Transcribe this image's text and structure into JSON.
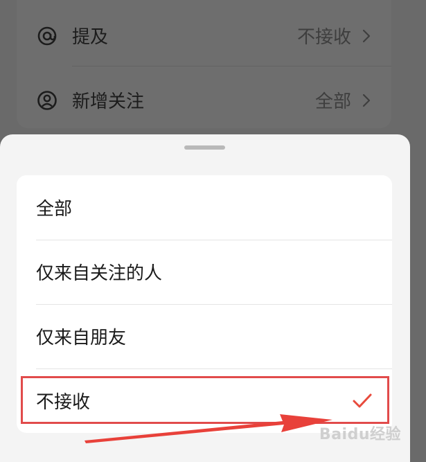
{
  "background": {
    "rows": [
      {
        "icon": "at-icon",
        "label": "提及",
        "value": "不接收"
      },
      {
        "icon": "user-circle-icon",
        "label": "新增关注",
        "value": "全部"
      }
    ]
  },
  "sheet": {
    "options": [
      {
        "label": "全部",
        "selected": false
      },
      {
        "label": "仅来自关注的人",
        "selected": false
      },
      {
        "label": "仅来自朋友",
        "selected": false
      },
      {
        "label": "不接收",
        "selected": true
      }
    ]
  },
  "colors": {
    "check": "#e84a3c",
    "highlight": "#e14b4b"
  },
  "watermark": "Baidu经验"
}
